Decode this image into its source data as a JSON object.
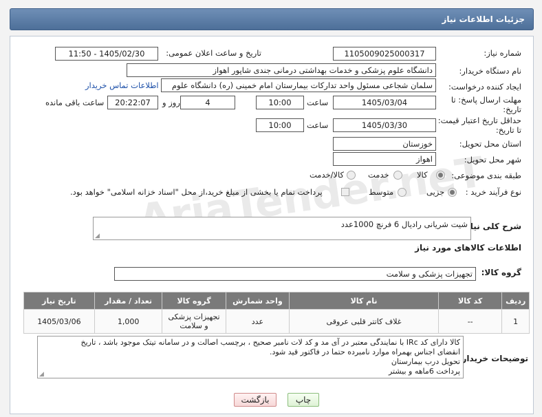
{
  "header": {
    "title": "جزئیات اطلاعات نیاز"
  },
  "fields": {
    "need_number_label": "شماره نیاز:",
    "need_number": "1105009025000317",
    "announce_label": "تاریخ و ساعت اعلان عمومی:",
    "announce_value": "1405/02/30 - 11:50",
    "buyer_org_label": "نام دستگاه خریدار:",
    "buyer_org": "دانشگاه علوم پزشکی و خدمات بهداشتی درمانی جندی شاپور اهواز",
    "requester_label": "ایجاد کننده درخواست:",
    "requester": "سلمان شجاعی مسئول واحد تدارکات بیمارستان امام خمینی (ره) دانشگاه علوم",
    "contact_link": "اطلاعات تماس خریدار",
    "reply_deadline_label_1": "مهلت ارسال پاسخ: تا",
    "reply_deadline_label_2": "تاریخ:",
    "reply_date": "1405/03/04",
    "time_label": "ساعت",
    "reply_time": "10:00",
    "days_value": "4",
    "days_label": "روز و",
    "remaining_time": "20:22:07",
    "remaining_label": "ساعت باقی مانده",
    "price_validity_label_1": "حداقل تاریخ اعتبار قیمت:",
    "price_validity_label_2": "تا تاریخ:",
    "price_date": "1405/03/30",
    "price_time": "10:00",
    "province_label": "استان محل تحویل:",
    "province": "خوزستان",
    "city_label": "شهر محل تحویل:",
    "city": "اهواز",
    "category_label": "طبقه بندی موضوعی:",
    "category_options": [
      "کالا",
      "خدمت",
      "کالا/خدمت"
    ],
    "purchase_type_label": "نوع فرآیند خرید :",
    "purchase_options": [
      "جزیی",
      "متوسط"
    ],
    "payment_note": "پرداخت تمام یا بخشی از مبلغ خرید،از محل \"اسناد خزانه اسلامی\" خواهد بود."
  },
  "summary": {
    "label": "شرح کلی نیاز:",
    "text": "شیت شریانی رادیال 6 فرنچ    1000عدد"
  },
  "goods_section_title": "اطلاعات کالاهای مورد نیاز",
  "goods_group": {
    "label": "گروه کالا:",
    "value": "تجهیزات پزشکی و سلامت"
  },
  "table": {
    "headers": [
      "ردیف",
      "کد کالا",
      "نام کالا",
      "واحد شمارش",
      "گروه کالا",
      "تعداد / مقدار",
      "تاریخ نیاز"
    ],
    "rows": [
      [
        "1",
        "--",
        "غلاف کاتتر قلبی عروقی",
        "عدد",
        "تجهیزات پزشکی و سلامت",
        "1,000",
        "1405/03/06"
      ]
    ]
  },
  "buyer_notes": {
    "label": "توضیحات خریدار:",
    "lines": [
      "کالا دارای کد IRc با نمایندگی معتبر در آی مد و کد لات نامبر صحیح ، برچسب اصالت و در سامانه تیتک موجود باشد ، تاریخ",
      "انقضای اجناس بهمراه موارد نامبرده حتما در فاکتور قید شود.",
      "تحویل درب بیمارستان",
      "پرداخت 6ماهه و بیشتر"
    ]
  },
  "buttons": {
    "print": "چاپ",
    "back": "بازگشت"
  },
  "watermark": "AriaTender.neT"
}
